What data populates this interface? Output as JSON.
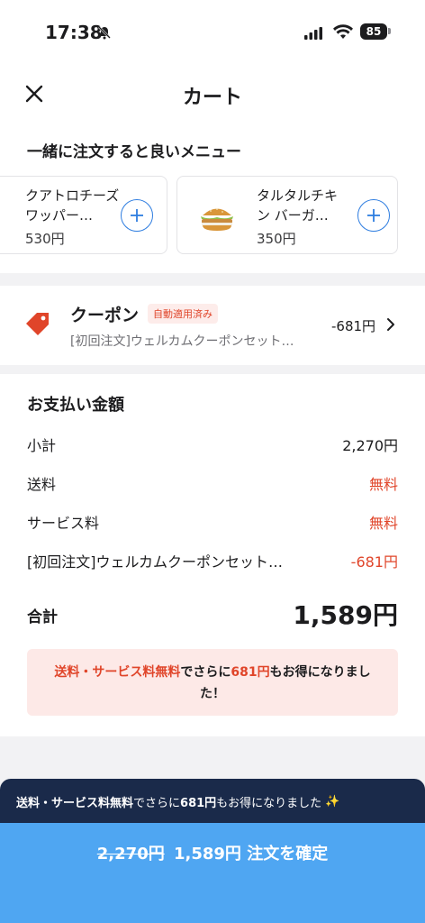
{
  "status": {
    "time": "17:38",
    "battery": "85"
  },
  "header": {
    "title": "カート"
  },
  "recommend": {
    "title": "一緒に注文すると良いメニュー",
    "items": [
      {
        "name": "クアトロチーズ ワッパー…",
        "price": "530円"
      },
      {
        "name": "タルタルチキン バーガ…",
        "price": "350円"
      }
    ]
  },
  "coupon": {
    "title": "クーポン",
    "badge": "自動適用済み",
    "description": "[初回注文]ウェルカムクーポンセット…",
    "amount": "-681円"
  },
  "payment": {
    "title": "お支払い金額",
    "rows": [
      {
        "label": "小計",
        "value": "2,270円"
      },
      {
        "label": "送料",
        "value": "無料"
      },
      {
        "label": "サービス料",
        "value": "無料"
      },
      {
        "label": "[初回注文]ウェルカムクーポンセット…",
        "value": "-681円"
      }
    ],
    "total_label": "合計",
    "total_value": "1,589円",
    "savings": {
      "part1": "送料・サービス料無料",
      "part2": "でさらに",
      "part3": "681円",
      "part4": "もお得になりました！"
    }
  },
  "banner": {
    "part1": "送料・サービス料無料",
    "part2": "でさらに",
    "part3": "681円",
    "part4": "もお得になりました",
    "emoji": "✨"
  },
  "order": {
    "original": "2,270円",
    "price": "1,589円",
    "label": "注文を確定"
  },
  "colors": {
    "accent": "#2e7de0",
    "red": "#e0452a",
    "button": "#4fa6f2",
    "banner": "#1a2a4a"
  }
}
